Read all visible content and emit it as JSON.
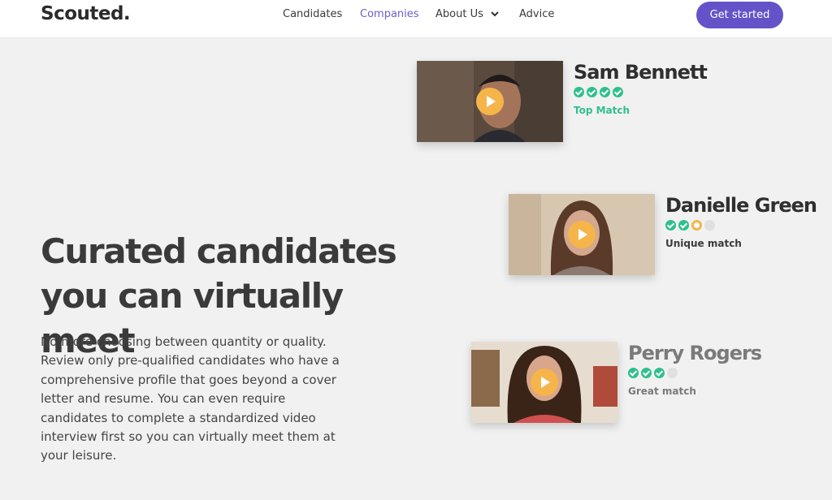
{
  "nav": {
    "logo": "Scouted.",
    "links": [
      {
        "label": "Candidates"
      },
      {
        "label": "Companies"
      },
      {
        "label": "About Us"
      },
      {
        "label": "Advice"
      }
    ],
    "cta": "Get started"
  },
  "hero": {
    "title": "Curated candidates you can virtually meet",
    "body": "No more choosing between quantity or quality. Review only pre-qualified candidates who have a comprehensive profile that goes beyond a cover letter and resume. You can even require candidates to complete a standardized video interview first so you can virtually meet them at your leisure."
  },
  "candidates": [
    {
      "name": "Sam Bennett",
      "rating": "4 of 4",
      "match": "Top Match",
      "match_color": "#2fc08d"
    },
    {
      "name": "Danielle Green",
      "rating": "2 of 4 plus highlight",
      "match": "Unique match",
      "match_color": "#3a3a3a"
    },
    {
      "name": "Perry Rogers",
      "rating": "3 of 4",
      "match": "Great match",
      "match_color": "#7a7a7a"
    }
  ],
  "colors": {
    "accent": "#6453c8",
    "active_link": "#6a5fd0",
    "check_green": "#2fc08d",
    "play_orange": "#f5b54a"
  }
}
